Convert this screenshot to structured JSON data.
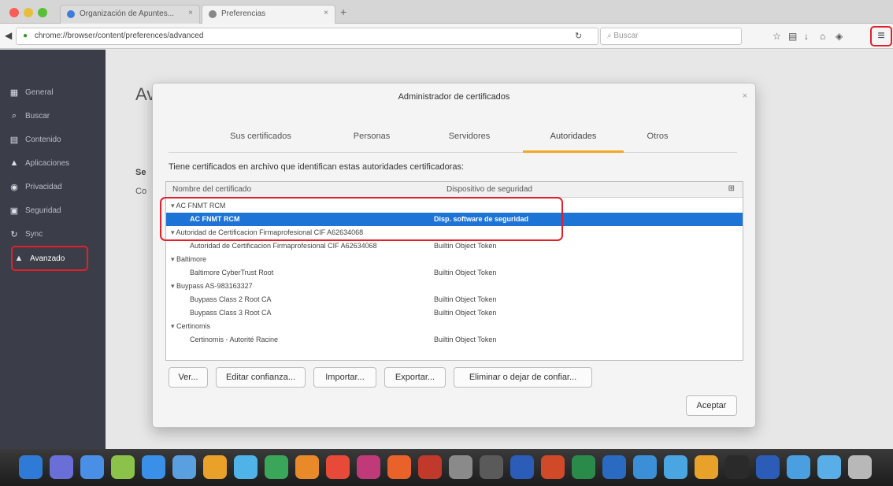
{
  "browser": {
    "tabs": [
      {
        "label": "Organización de Apuntes..."
      },
      {
        "label": "Preferencias"
      }
    ],
    "url": "chrome://browser/content/preferences/advanced",
    "search_placeholder": "Buscar"
  },
  "sidebar": {
    "items": [
      {
        "label": "General",
        "icon": "general-icon"
      },
      {
        "label": "Buscar",
        "icon": "search-icon"
      },
      {
        "label": "Contenido",
        "icon": "content-icon"
      },
      {
        "label": "Aplicaciones",
        "icon": "applications-icon"
      },
      {
        "label": "Privacidad",
        "icon": "privacy-icon"
      },
      {
        "label": "Seguridad",
        "icon": "security-icon"
      },
      {
        "label": "Sync",
        "icon": "sync-icon"
      },
      {
        "label": "Avanzado",
        "icon": "advanced-icon"
      }
    ]
  },
  "page": {
    "title": "Av",
    "frag1": "Se",
    "frag2": "Co"
  },
  "dialog": {
    "title": "Administrador de certificados",
    "tabs": [
      "Sus certificados",
      "Personas",
      "Servidores",
      "Autoridades",
      "Otros"
    ],
    "selected_tab": "Autoridades",
    "intro": "Tiene certificados en archivo que identifican estas autoridades certificadoras:",
    "columns": [
      "Nombre del certificado",
      "Dispositivo de seguridad"
    ],
    "rows": [
      {
        "type": "group",
        "name": "AC FNMT RCM"
      },
      {
        "type": "child",
        "name": "AC FNMT RCM",
        "device": "Disp. software de seguridad",
        "selected": true
      },
      {
        "type": "group",
        "name": "Autoridad de Certificacion Firmaprofesional CIF A62634068"
      },
      {
        "type": "child",
        "name": "Autoridad de Certificacion Firmaprofesional CIF A62634068",
        "device": "Builtin Object Token"
      },
      {
        "type": "group",
        "name": "Baltimore"
      },
      {
        "type": "child",
        "name": "Baltimore CyberTrust Root",
        "device": "Builtin Object Token"
      },
      {
        "type": "group",
        "name": "Buypass AS-983163327"
      },
      {
        "type": "child",
        "name": "Buypass Class 2 Root CA",
        "device": "Builtin Object Token"
      },
      {
        "type": "child",
        "name": "Buypass Class 3 Root CA",
        "device": "Builtin Object Token"
      },
      {
        "type": "group",
        "name": "Certinomis"
      },
      {
        "type": "child",
        "name": "Certinomis - Autorité Racine",
        "device": "Builtin Object Token"
      }
    ],
    "buttons": {
      "view": "Ver...",
      "edit_trust": "Editar confianza...",
      "import": "Importar...",
      "export": "Exportar...",
      "delete": "Eliminar o dejar de confiar...",
      "accept": "Aceptar"
    }
  },
  "dock": {
    "icons": [
      "finder-icon",
      "siri-icon",
      "safari-icon",
      "photos-icon",
      "appstore-icon",
      "preview-icon",
      "chrome-icon",
      "network-icon",
      "numbers-icon",
      "books-icon",
      "calendar-icon",
      "itunes-icon",
      "firefox-icon",
      "mahjong-icon",
      "settings-icon",
      "monitor-icon",
      "word-icon",
      "powerpoint-icon",
      "excel-icon",
      "outlook-icon",
      "folder-icon",
      "camera-icon",
      "browser-icon",
      "terminal-icon",
      "word2-icon",
      "folder2-icon",
      "folder3-icon",
      "trash-icon"
    ],
    "colors": [
      "#2f7ad6",
      "#6a6fd8",
      "#4a8fe6",
      "#8bc34a",
      "#3a8fe8",
      "#5aa0e0",
      "#e9a12a",
      "#4fb3e8",
      "#3aa65a",
      "#e88a2a",
      "#e84a3a",
      "#c03a7a",
      "#e8622a",
      "#c0392b",
      "#8a8a8a",
      "#5a5a5a",
      "#2b5cb8",
      "#d04a2a",
      "#2a8a4a",
      "#2a6ac0",
      "#3a8fd6",
      "#4aa6e0",
      "#e8a22a",
      "#2a2a2a",
      "#2b5cb8",
      "#4a9fe0",
      "#5aaee8",
      "#b8b8b8"
    ]
  }
}
